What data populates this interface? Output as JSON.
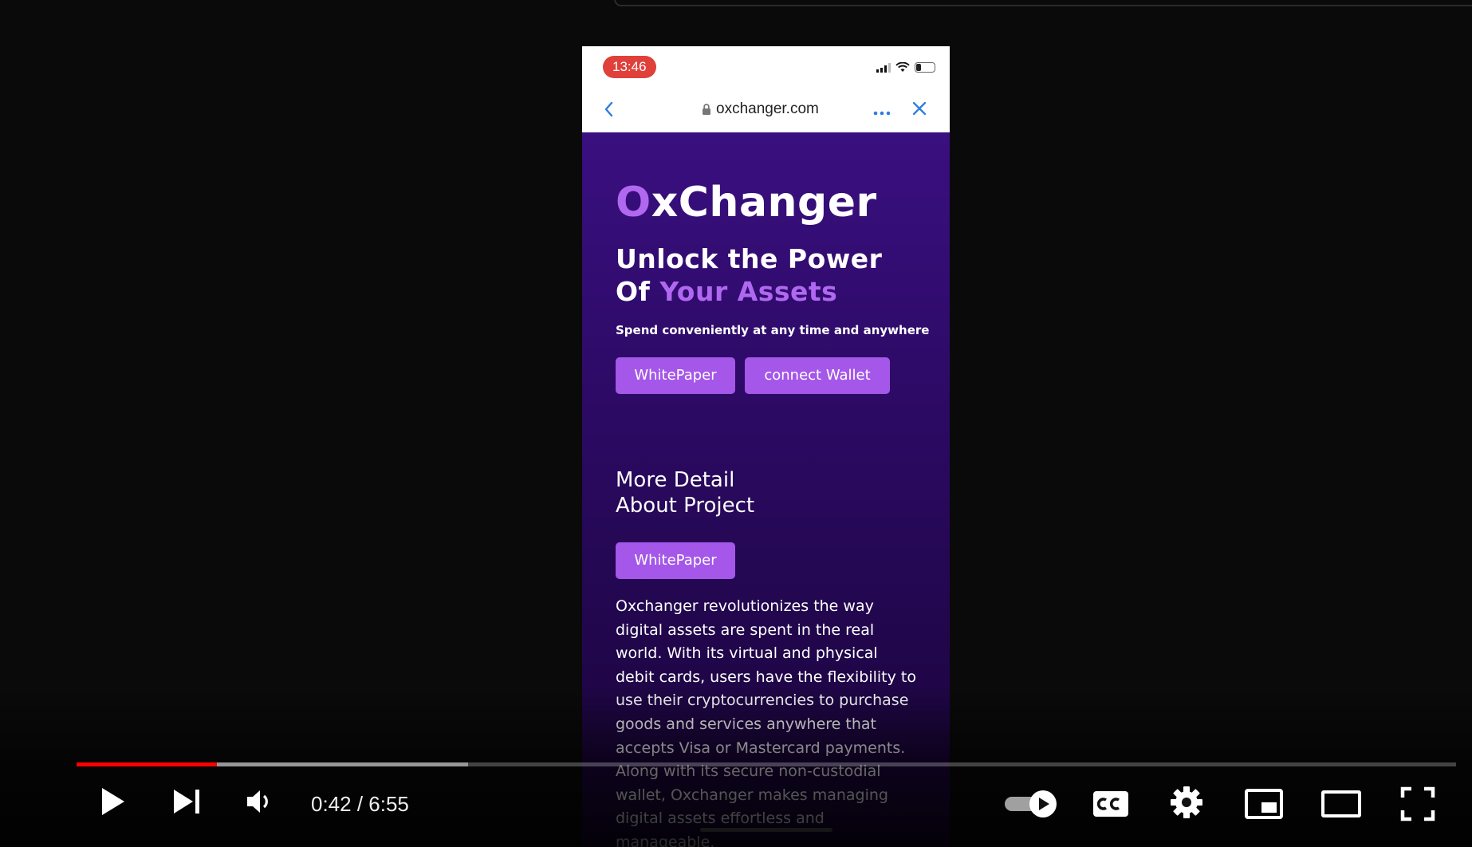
{
  "phone": {
    "status_time": "13:46",
    "battery": "25",
    "url": "oxchanger.com",
    "site": {
      "brand_initial": "O",
      "brand_rest": "xChanger",
      "hero_line1": "Unlock the Power",
      "hero_line2_plain": "Of ",
      "hero_line2_accent": "Your Assets",
      "subtitle": "Spend conveniently at any time and anywhere",
      "whitepaper_label": "WhitePaper",
      "connect_wallet_label": "connect Wallet",
      "more_detail_line1": "More Detail",
      "more_detail_line2": "About Project",
      "whitepaper2_label": "WhitePaper",
      "description": "Oxchanger revolutionizes the way digital assets are spent in the real world. With its virtual and physical debit cards, users have the flexibility to use their cryptocurrencies to purchase goods and services anywhere that accepts Visa or Mastercard payments. Along with its secure non-custodial wallet, Oxchanger makes managing digital assets effortless and manageable."
    }
  },
  "player": {
    "time_display": "0:42 / 6:55",
    "progress_played": 0.102,
    "progress_buffered": 0.284,
    "colors": {
      "played": "#ff0000",
      "accent": "#a457e8"
    },
    "icons": [
      "play-icon",
      "next-icon",
      "volume-icon",
      "autoplay-icon",
      "cc-icon",
      "settings-icon",
      "miniplayer-icon",
      "theater-icon",
      "fullscreen-icon"
    ]
  }
}
